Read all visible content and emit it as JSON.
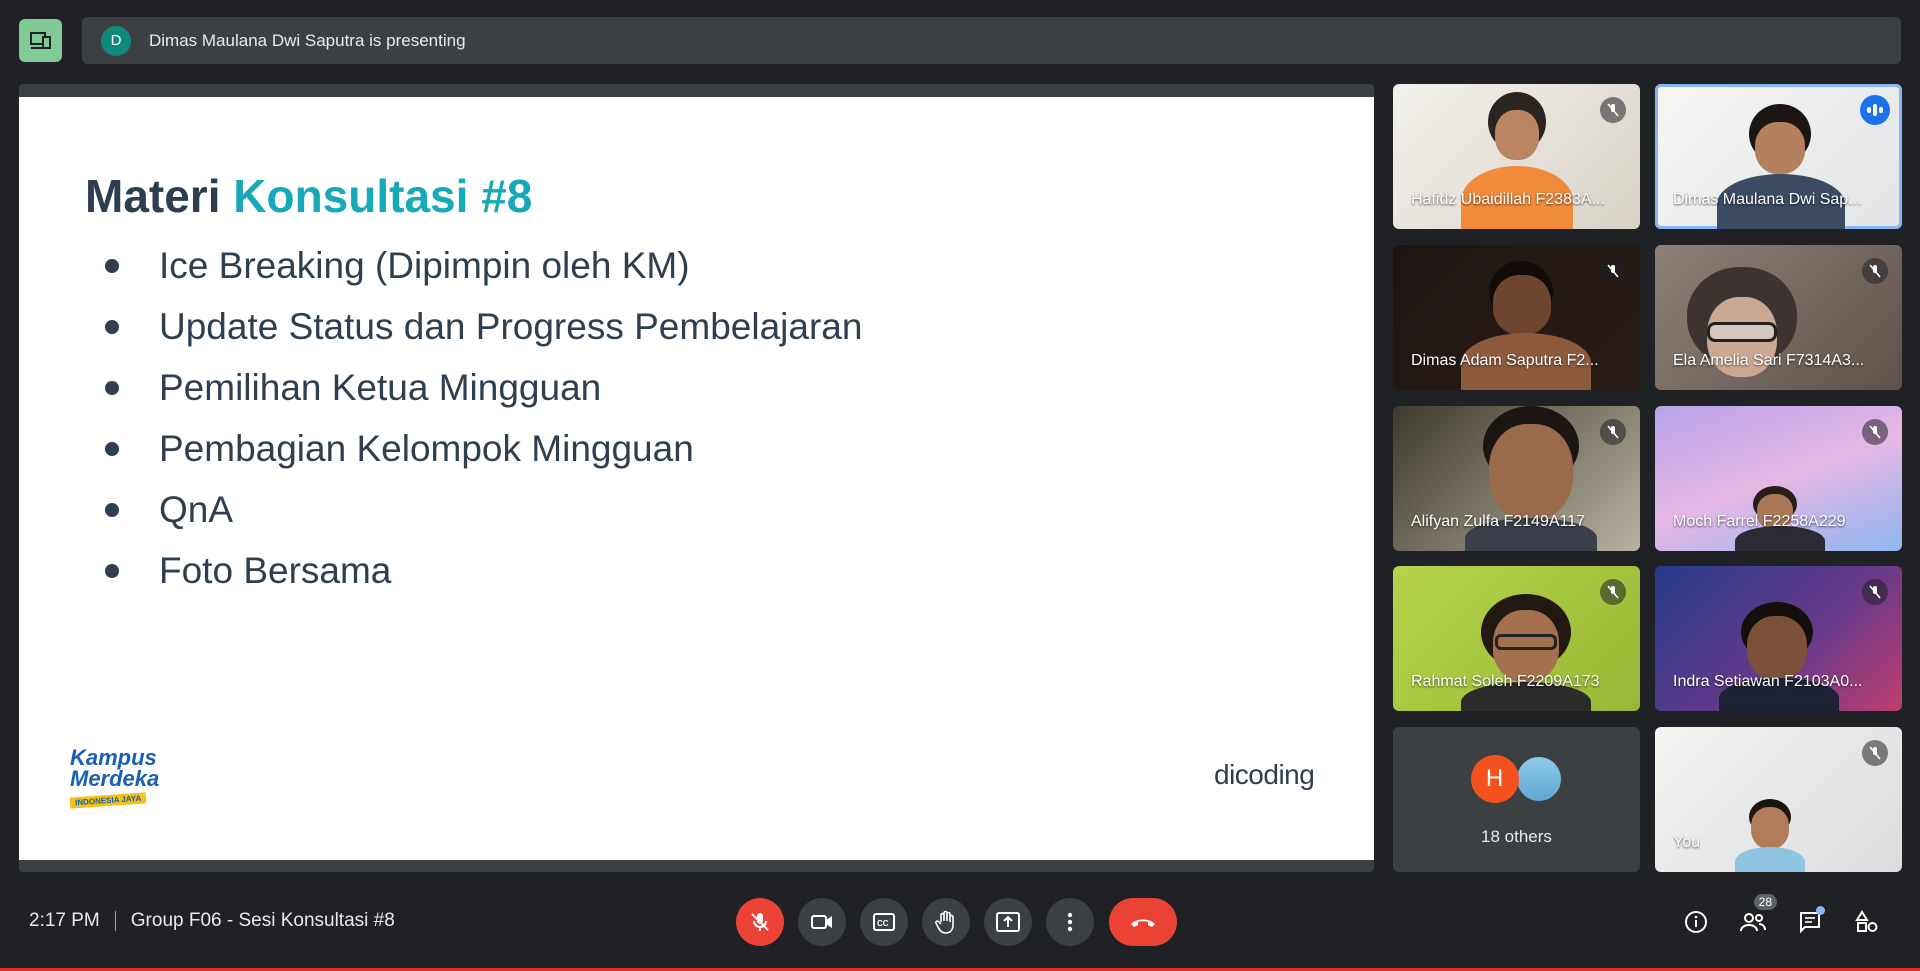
{
  "presenting": {
    "avatar_initial": "D",
    "text": "Dimas Maulana Dwi Saputra is presenting"
  },
  "slide": {
    "title_main": "Materi",
    "title_accent": "Konsultasi #8",
    "bullets": [
      "Ice Breaking (Dipimpin oleh KM)",
      "Update Status dan Progress Pembelajaran",
      "Pemilihan Ketua Mingguan",
      "Pembagian Kelompok Mingguan",
      "QnA",
      "Foto Bersama"
    ],
    "logo_left_line1": "Kampus",
    "logo_left_line2": "Merdeka",
    "logo_left_tagline": "INDONESIA JAYA",
    "logo_right": "dicoding"
  },
  "participants": [
    {
      "name": "Hafidz Ubaidillah F2383A...",
      "status": "muted"
    },
    {
      "name": "Dimas Maulana Dwi Sap...",
      "status": "speaking"
    },
    {
      "name": "Dimas Adam Saputra F2...",
      "status": "muted"
    },
    {
      "name": "Ela Amelia Sari F7314A3...",
      "status": "muted"
    },
    {
      "name": "Alifyan Zulfa F2149A117",
      "status": "muted"
    },
    {
      "name": "Moch Farrel F2258A229",
      "status": "muted"
    },
    {
      "name": "Rahmat Soleh F2209A173",
      "status": "muted"
    },
    {
      "name": "Indra Setiawan F2103A0...",
      "status": "muted"
    },
    {
      "name": "You",
      "status": "muted"
    }
  ],
  "others": {
    "avatar_initial": "H",
    "label": "18 others"
  },
  "bottom": {
    "time": "2:17 PM",
    "meeting_name": "Group F06 - Sesi Konsultasi #8",
    "people_count": "28"
  },
  "colors": {
    "accent_teal": "#17a9b8",
    "leave_red": "#ea4335",
    "speaking_blue": "#1a73e8",
    "present_green": "#81c995"
  },
  "icons": [
    "present-screen-icon",
    "mic-off-icon",
    "camera-icon",
    "captions-icon",
    "raise-hand-icon",
    "present-now-icon",
    "more-options-icon",
    "end-call-icon",
    "info-icon",
    "people-icon",
    "chat-icon",
    "activities-icon"
  ]
}
